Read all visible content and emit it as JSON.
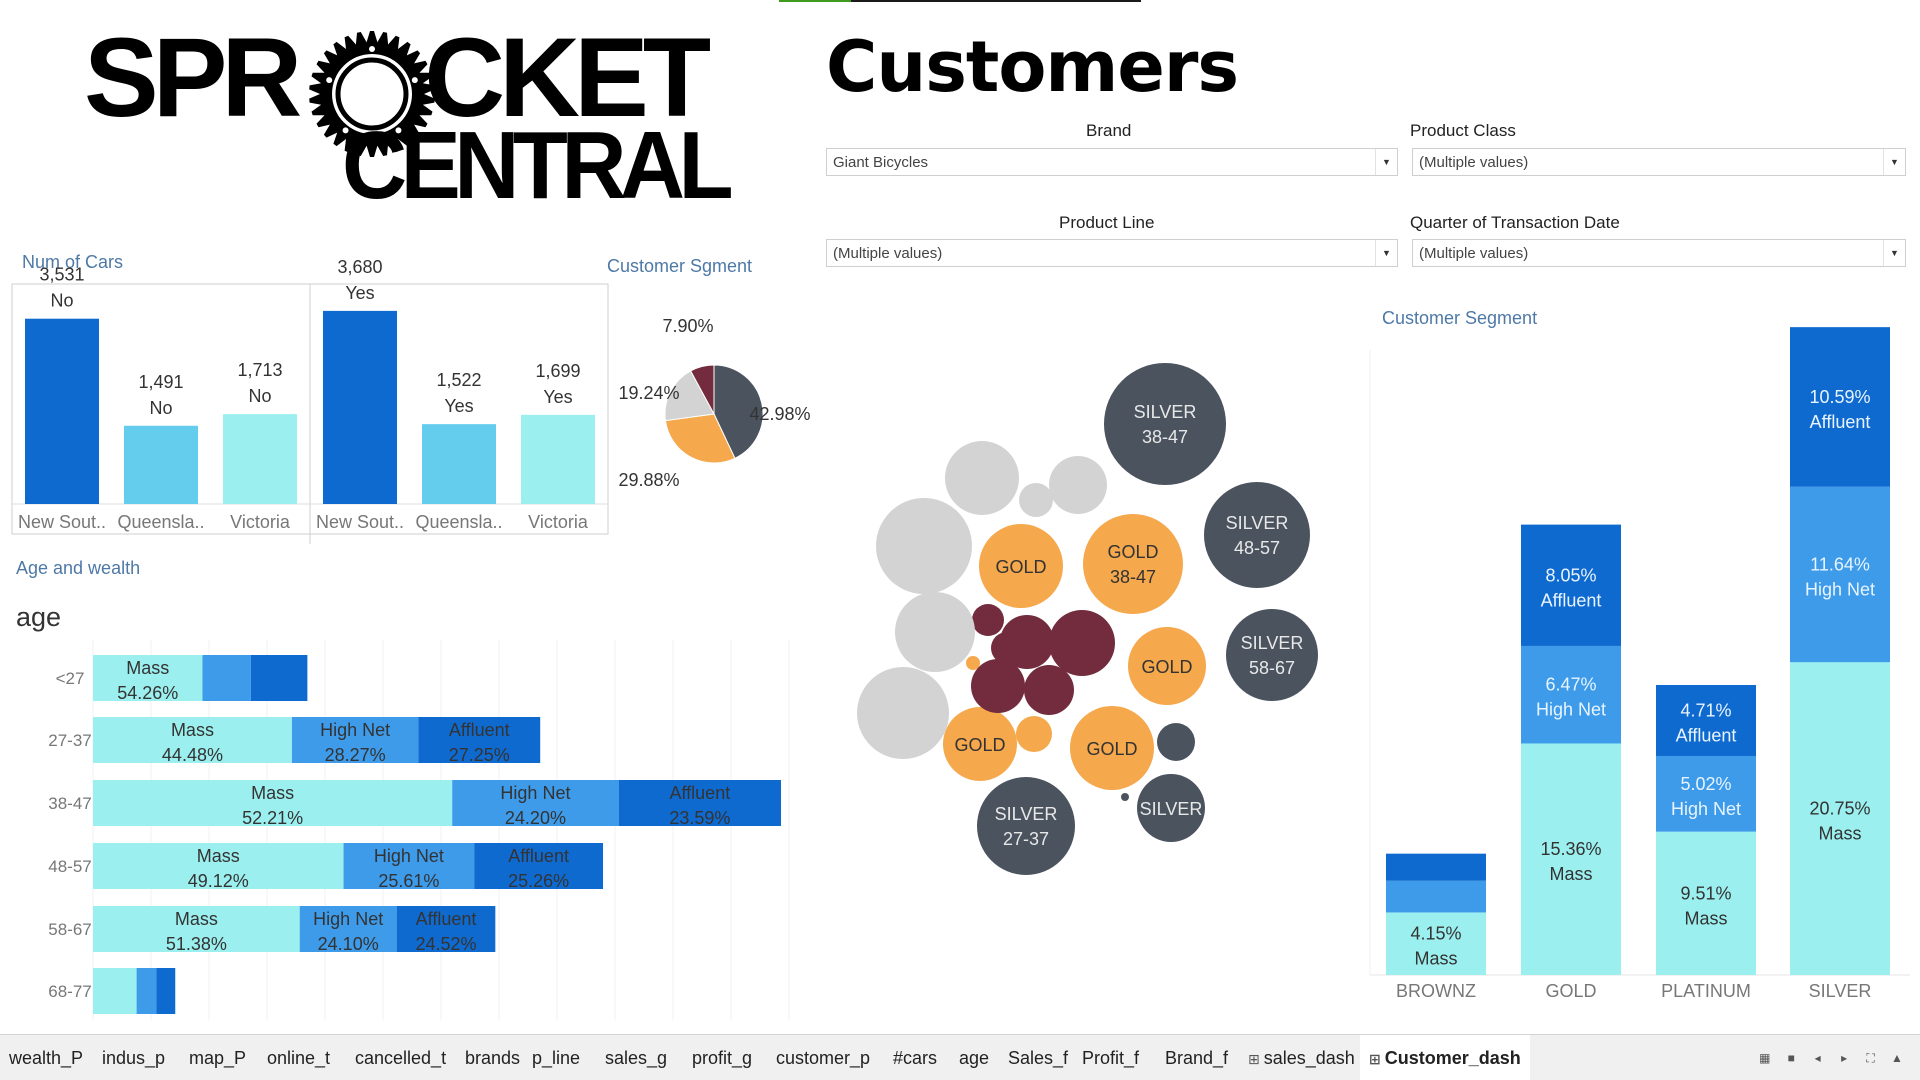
{
  "logo": {
    "line1_left": "SPR",
    "line1_right": "CKET",
    "line2": "CENTRAL"
  },
  "title": "Customers",
  "filters": [
    {
      "label": "Brand",
      "value": "Giant Bicycles"
    },
    {
      "label": "Product Class",
      "value": "(Multiple values)"
    },
    {
      "label": "Product Line",
      "value": "(Multiple values)"
    },
    {
      "label": "Quarter of Transaction Date",
      "value": "(Multiple values)"
    }
  ],
  "sections": {
    "cars_title": "Num of Cars",
    "pie_title": "Customer Sgment",
    "age_title": "Age and wealth",
    "age_axis_title": "age",
    "segment_title": "Customer Segment"
  },
  "colors": {
    "dark_blue": "#0f6ad0",
    "mid_blue": "#3d9bea",
    "light_blue": "#64cdee",
    "cyan": "#9bf0ef",
    "silver": "#4b535f",
    "gold": "#f5a84c",
    "bronze": "#722c3e",
    "grey": "#d3d3d3"
  },
  "chart_data": [
    {
      "name_id": "num-of-cars",
      "type": "bar",
      "panels": [
        {
          "label": "No",
          "categories": [
            "New Sout..",
            "Queensla..",
            "Victoria"
          ],
          "values": [
            3531,
            1491,
            1713
          ],
          "value_labels": [
            "3,531",
            "1,491",
            "1,713"
          ]
        },
        {
          "label": "Yes",
          "categories": [
            "New Sout..",
            "Queensla..",
            "Victoria"
          ],
          "values": [
            3680,
            1522,
            1699
          ],
          "value_labels": [
            "3,680",
            "1,522",
            "1,699"
          ]
        }
      ],
      "ylim": [
        0,
        4200
      ],
      "grid": false
    },
    {
      "name_id": "customer-sgment-pie",
      "type": "pie",
      "slices": [
        {
          "label": "42.98%",
          "value": 42.98,
          "color": "#4b535f"
        },
        {
          "label": "29.88%",
          "value": 29.88,
          "color": "#f5a84c"
        },
        {
          "label": "19.24%",
          "value": 19.24,
          "color": "#d3d3d3"
        },
        {
          "label": "",
          "value": 7.9,
          "color": "#722c3e"
        }
      ],
      "top_label": "7.90%"
    },
    {
      "name_id": "age-and-wealth",
      "type": "bar",
      "orientation": "horizontal",
      "stacked": true,
      "categories": [
        "<27",
        "27-37",
        "38-47",
        "48-57",
        "58-67",
        "68-77"
      ],
      "series": [
        {
          "name": "Mass",
          "values": [
            54.26,
            44.48,
            52.21,
            49.12,
            51.38,
            53
          ],
          "labels": [
            "Mass\n54.26%",
            "Mass\n44.48%",
            "Mass\n52.21%",
            "Mass\n49.12%",
            "Mass\n51.38%",
            ""
          ],
          "color": "#9bf0ef"
        },
        {
          "name": "High Net",
          "values": [
            24,
            28.27,
            24.2,
            25.61,
            24.1,
            24
          ],
          "labels": [
            "",
            "High Net\n28.27%",
            "High Net\n24.20%",
            "High Net\n25.61%",
            "High Net\n24.10%",
            ""
          ],
          "color": "#3d9bea"
        },
        {
          "name": "Affluent",
          "values": [
            28,
            27.25,
            23.59,
            25.26,
            24.52,
            23
          ],
          "labels": [
            "",
            "Affluent\n27.25%",
            "Affluent\n23.59%",
            "Affluent\n25.26%",
            "Affluent\n24.52%",
            ""
          ],
          "color": "#0f6ad0"
        }
      ],
      "row_totals": [
        430,
        897,
        1380,
        1023,
        807,
        165
      ]
    },
    {
      "name_id": "customer-segment-bubbles",
      "type": "scatter",
      "bubbles": [
        {
          "label": "SILVER\n38-47",
          "size": 61,
          "color": "#4b535f"
        },
        {
          "label": "SILVER\n48-57",
          "size": 53,
          "color": "#4b535f"
        },
        {
          "label": "SILVER\n58-67",
          "size": 46,
          "color": "#4b535f"
        },
        {
          "label": "SILVER\n27-37",
          "size": 49,
          "color": "#4b535f"
        },
        {
          "label": "SILVER",
          "size": 34,
          "color": "#4b535f"
        },
        {
          "label": "",
          "size": 19,
          "color": "#4b535f"
        },
        {
          "label": "",
          "size": 4,
          "color": "#4b535f"
        },
        {
          "label": "GOLD\n38-47",
          "size": 50,
          "color": "#f5a84c"
        },
        {
          "label": "GOLD",
          "size": 42,
          "color": "#f5a84c"
        },
        {
          "label": "GOLD",
          "size": 42,
          "color": "#f5a84c"
        },
        {
          "label": "GOLD",
          "size": 39,
          "color": "#f5a84c"
        },
        {
          "label": "GOLD",
          "size": 37,
          "color": "#f5a84c"
        },
        {
          "label": "",
          "size": 18,
          "color": "#f5a84c"
        },
        {
          "label": "",
          "size": 7,
          "color": "#f5a84c"
        },
        {
          "label": "",
          "size": 33,
          "color": "#722c3e"
        },
        {
          "label": "",
          "size": 27,
          "color": "#722c3e"
        },
        {
          "label": "",
          "size": 27,
          "color": "#722c3e"
        },
        {
          "label": "",
          "size": 25,
          "color": "#722c3e"
        },
        {
          "label": "",
          "size": 16,
          "color": "#722c3e"
        },
        {
          "label": "",
          "size": 16,
          "color": "#722c3e"
        },
        {
          "label": "",
          "size": 37,
          "color": "#d3d3d3"
        },
        {
          "label": "",
          "size": 48,
          "color": "#d3d3d3"
        },
        {
          "label": "",
          "size": 40,
          "color": "#d3d3d3"
        },
        {
          "label": "",
          "size": 46,
          "color": "#d3d3d3"
        },
        {
          "label": "",
          "size": 29,
          "color": "#d3d3d3"
        },
        {
          "label": "",
          "size": 17,
          "color": "#d3d3d3"
        }
      ]
    },
    {
      "name_id": "customer-segment-stacked",
      "type": "bar",
      "stacked": true,
      "categories": [
        "BROWNZ",
        "GOLD",
        "PLATINUM",
        "SILVER"
      ],
      "series": [
        {
          "name": "Mass",
          "values": [
            4.15,
            15.36,
            9.51,
            20.75
          ],
          "labels": [
            "4.15%\nMass",
            "15.36%\nMass",
            "9.51%\nMass",
            "20.75%\nMass"
          ],
          "color": "#9bf0ef"
        },
        {
          "name": "High Net",
          "values": [
            2.1,
            6.47,
            5.02,
            11.64
          ],
          "labels": [
            "",
            "6.47%\nHigh Net",
            "5.02%\nHigh Net",
            "11.64%\nHigh Net"
          ],
          "color": "#3d9bea"
        },
        {
          "name": "Affluent",
          "values": [
            1.8,
            8.05,
            4.71,
            10.59
          ],
          "labels": [
            "",
            "8.05%\nAffluent",
            "4.71%\nAffluent",
            "10.59%\nAffluent"
          ],
          "color": "#0f6ad0"
        }
      ],
      "ylim": [
        0,
        45
      ]
    }
  ],
  "tabs": [
    {
      "label": "wealth_P"
    },
    {
      "label": "indus_p"
    },
    {
      "label": "map_P"
    },
    {
      "label": "online_t"
    },
    {
      "label": "cancelled_t"
    },
    {
      "label": "brands"
    },
    {
      "label": "p_line"
    },
    {
      "label": "sales_g"
    },
    {
      "label": "profit_g"
    },
    {
      "label": "customer_p"
    },
    {
      "label": "#cars"
    },
    {
      "label": "age"
    },
    {
      "label": "Sales_f"
    },
    {
      "label": "Profit_f"
    },
    {
      "label": "Brand_f"
    },
    {
      "label": "sales_dash",
      "icon": "dashboard-icon"
    },
    {
      "label": "Customer_dash",
      "icon": "dashboard-icon",
      "active": true
    }
  ],
  "tab_tools": [
    "grid-view-icon",
    "filmstrip-view-icon",
    "prev-icon",
    "next-icon",
    "fullscreen-icon",
    "present-icon"
  ]
}
